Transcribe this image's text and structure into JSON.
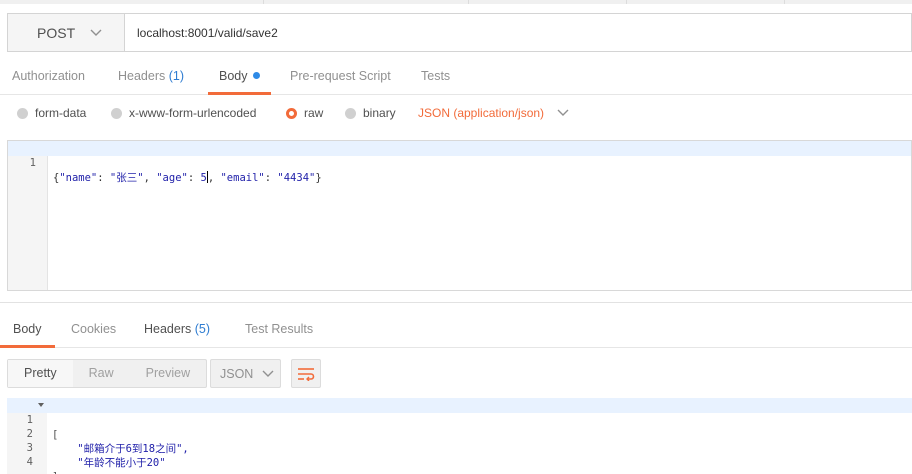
{
  "request": {
    "method": "POST",
    "url": "localhost:8001/valid/save2",
    "tabs": {
      "authorization": "Authorization",
      "headers": "Headers",
      "headers_count": "(1)",
      "body": "Body",
      "prerequest": "Pre-request Script",
      "tests": "Tests"
    },
    "body_types": {
      "form_data": "form-data",
      "urlencoded": "x-www-form-urlencoded",
      "raw": "raw",
      "binary": "binary",
      "selected": "raw"
    },
    "content_type": "JSON (application/json)",
    "code": {
      "line_number": "1",
      "k_name": "\"name\"",
      "v_name": "\"张三\"",
      "k_age": "\"age\"",
      "v_age": "5",
      "k_email": "\"email\"",
      "v_email": "\"4434\"",
      "open": "{",
      "close": "}",
      "colon": ": ",
      "comma": ", "
    }
  },
  "response": {
    "tabs": {
      "body": "Body",
      "cookies": "Cookies",
      "headers": "Headers",
      "headers_count": "(5)",
      "test_results": "Test Results"
    },
    "view_modes": [
      "Pretty",
      "Raw",
      "Preview"
    ],
    "active_view": "Pretty",
    "format": "JSON",
    "lines": [
      {
        "n": "1",
        "text": "["
      },
      {
        "n": "2",
        "text": "    \"邮箱介于6到18之间\","
      },
      {
        "n": "3",
        "text": "    \"年龄不能小于20\""
      },
      {
        "n": "4",
        "text": "]"
      }
    ]
  },
  "colors": {
    "accent": "#f26b3a",
    "count_blue": "#2e7cd1",
    "dot_blue": "#2e8ae6",
    "code_string": "#2222aa"
  },
  "icons": {
    "method_dropdown": "chevron-down-icon",
    "content_type_dropdown": "chevron-down-icon",
    "format_dropdown": "chevron-down-icon",
    "wrap": "wrap-lines-icon"
  }
}
